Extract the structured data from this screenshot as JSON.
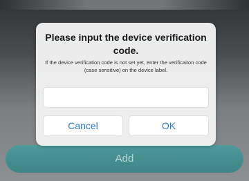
{
  "background": {
    "add_button_label": "Add"
  },
  "dialog": {
    "title": "Please input the device verification code.",
    "message": "If the device verification code is not set yet, enter the verificaiton code (case sensitive) on the device label.",
    "input": {
      "value": "",
      "placeholder": ""
    },
    "buttons": {
      "cancel_label": "Cancel",
      "ok_label": "OK"
    }
  },
  "colors": {
    "accent_blue": "#2f78d3",
    "add_button_teal": "#4e9a9c",
    "dialog_background": "#f3f3f3"
  }
}
